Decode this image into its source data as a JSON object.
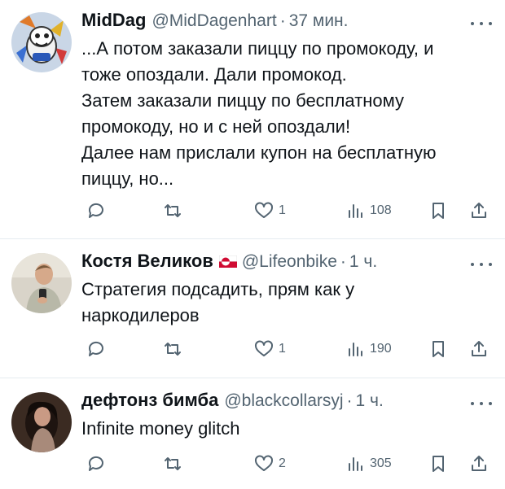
{
  "tweets": [
    {
      "name": "MidDag",
      "handle": "@MidDagenhart",
      "time": "37 мин.",
      "text": "...А потом заказали пиццу по промокоду, и\nтоже опоздали. Дали промокод.\nЗатем заказали пиццу по бесплатному\nпромокоду, но и с ней опоздали!\nДалее нам прислали купон на бесплатную\nпиццу, но...",
      "likes": "1",
      "views": "108",
      "avatar_icon": "cartoon-mascot-avatar"
    },
    {
      "name": "Костя Великов",
      "handle": "@Lifeonbike",
      "time": "1 ч.",
      "text": "Стратегия подсадить, прям как у\nнаркодилеров",
      "likes": "1",
      "views": "190",
      "flag_icon": "greenland-flag-icon"
    },
    {
      "name": "дефтонз бимба",
      "handle": "@blackcollarsyj",
      "time": "1 ч.",
      "text": "Infinite money glitch",
      "likes": "2",
      "views": "305"
    }
  ],
  "separator": "·",
  "colors": {
    "secondary": "#536471",
    "text": "#0f1419",
    "divider": "#e6ecf0"
  }
}
